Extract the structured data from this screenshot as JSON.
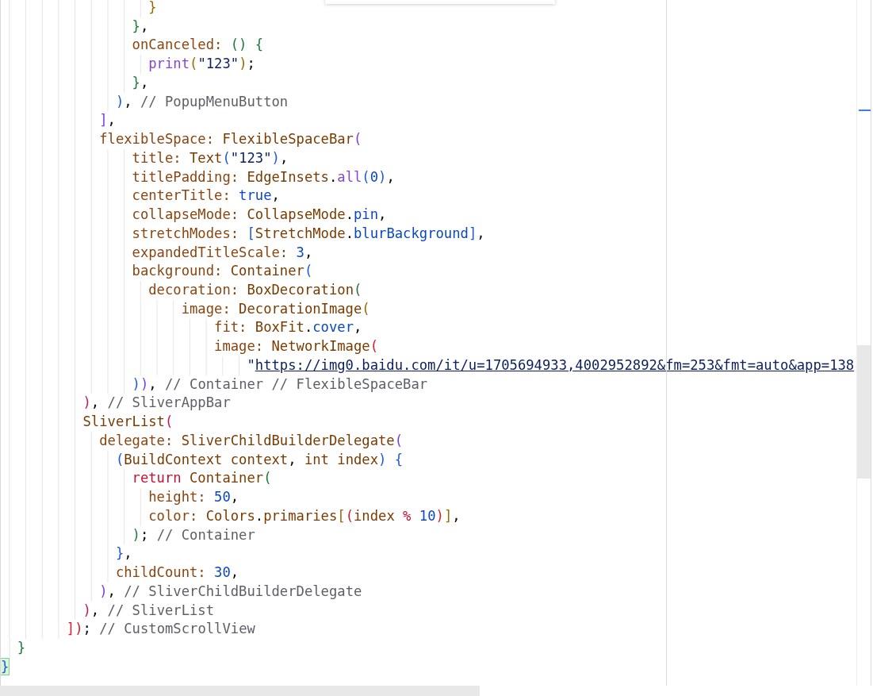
{
  "editor": {
    "lines": [
      {
        "tokens": [
          {
            "text": "                  }",
            "kind": "bo"
          }
        ]
      },
      {
        "tokens": [
          {
            "text": "                }",
            "kind": "bg"
          },
          {
            "text": ",",
            "kind": "p"
          }
        ]
      },
      {
        "tokens": [
          {
            "text": "                onCanceled: ",
            "kind": "k"
          },
          {
            "text": "()",
            "kind": "bg"
          },
          {
            "text": " {",
            "kind": "bg"
          }
        ]
      },
      {
        "tokens": [
          {
            "text": "                  print",
            "kind": "m"
          },
          {
            "text": "(",
            "kind": "bo"
          },
          {
            "text": "\"123\"",
            "kind": "s"
          },
          {
            "text": ")",
            "kind": "bo"
          },
          {
            "text": ";",
            "kind": "p"
          }
        ]
      },
      {
        "tokens": [
          {
            "text": "                }",
            "kind": "bg"
          },
          {
            "text": ",",
            "kind": "p"
          }
        ]
      },
      {
        "tokens": [
          {
            "text": "              )",
            "kind": "bb"
          },
          {
            "text": ", ",
            "kind": "p"
          },
          {
            "text": "// PopupMenuButton",
            "kind": "cm"
          }
        ]
      },
      {
        "tokens": [
          {
            "text": "            ]",
            "kind": "bp"
          },
          {
            "text": ",",
            "kind": "p"
          }
        ]
      },
      {
        "tokens": [
          {
            "text": "            flexibleSpace: ",
            "kind": "k"
          },
          {
            "text": "FlexibleSpaceBar",
            "kind": "c"
          },
          {
            "text": "(",
            "kind": "bp"
          }
        ]
      },
      {
        "tokens": [
          {
            "text": "                title: ",
            "kind": "k"
          },
          {
            "text": "Text",
            "kind": "c"
          },
          {
            "text": "(",
            "kind": "bb"
          },
          {
            "text": "\"123\"",
            "kind": "s"
          },
          {
            "text": ")",
            "kind": "bb"
          },
          {
            "text": ",",
            "kind": "p"
          }
        ]
      },
      {
        "tokens": [
          {
            "text": "                titlePadding: ",
            "kind": "k"
          },
          {
            "text": "EdgeInsets",
            "kind": "c"
          },
          {
            "text": ".",
            "kind": "p"
          },
          {
            "text": "all",
            "kind": "m"
          },
          {
            "text": "(",
            "kind": "bb"
          },
          {
            "text": "0",
            "kind": "n"
          },
          {
            "text": ")",
            "kind": "bb"
          },
          {
            "text": ",",
            "kind": "p"
          }
        ]
      },
      {
        "tokens": [
          {
            "text": "                centerTitle: ",
            "kind": "k"
          },
          {
            "text": "true",
            "kind": "n"
          },
          {
            "text": ",",
            "kind": "p"
          }
        ]
      },
      {
        "tokens": [
          {
            "text": "                collapseMode: ",
            "kind": "k"
          },
          {
            "text": "CollapseMode",
            "kind": "c"
          },
          {
            "text": ".",
            "kind": "p"
          },
          {
            "text": "pin",
            "kind": "n"
          },
          {
            "text": ",",
            "kind": "p"
          }
        ]
      },
      {
        "tokens": [
          {
            "text": "                stretchModes: ",
            "kind": "k"
          },
          {
            "text": "[",
            "kind": "bb"
          },
          {
            "text": "StretchMode",
            "kind": "c"
          },
          {
            "text": ".",
            "kind": "p"
          },
          {
            "text": "blurBackground",
            "kind": "n"
          },
          {
            "text": "]",
            "kind": "bb"
          },
          {
            "text": ",",
            "kind": "p"
          }
        ]
      },
      {
        "tokens": [
          {
            "text": "                expandedTitleScale: ",
            "kind": "k"
          },
          {
            "text": "3",
            "kind": "n"
          },
          {
            "text": ",",
            "kind": "p"
          }
        ]
      },
      {
        "tokens": [
          {
            "text": "                background: ",
            "kind": "k"
          },
          {
            "text": "Container",
            "kind": "c"
          },
          {
            "text": "(",
            "kind": "bb"
          }
        ]
      },
      {
        "tokens": [
          {
            "text": "                  decoration: ",
            "kind": "k"
          },
          {
            "text": "BoxDecoration",
            "kind": "c"
          },
          {
            "text": "(",
            "kind": "bg"
          }
        ]
      },
      {
        "tokens": [
          {
            "text": "                      image: ",
            "kind": "k"
          },
          {
            "text": "DecorationImage",
            "kind": "c"
          },
          {
            "text": "(",
            "kind": "bo"
          }
        ]
      },
      {
        "tokens": [
          {
            "text": "                          fit: ",
            "kind": "k"
          },
          {
            "text": "BoxFit",
            "kind": "c"
          },
          {
            "text": ".",
            "kind": "p"
          },
          {
            "text": "cover",
            "kind": "n"
          },
          {
            "text": ",",
            "kind": "p"
          }
        ]
      },
      {
        "tokens": [
          {
            "text": "                          image: ",
            "kind": "k"
          },
          {
            "text": "NetworkImage",
            "kind": "c"
          },
          {
            "text": "(",
            "kind": "br"
          }
        ]
      },
      {
        "tokens": [
          {
            "text": "                              \"",
            "kind": "s"
          },
          {
            "text": "https://img0.baidu.com/it/u=1705694933,4002952892&fm=253&fmt=auto&app=138",
            "kind": "u"
          }
        ]
      },
      {
        "tokens": [
          {
            "text": "                )",
            "kind": "bb"
          },
          {
            "text": ")",
            "kind": "bp"
          },
          {
            "text": ", ",
            "kind": "p"
          },
          {
            "text": "// Container // FlexibleSpaceBar",
            "kind": "cm"
          }
        ]
      },
      {
        "tokens": [
          {
            "text": "          )",
            "kind": "bk"
          },
          {
            "text": ", ",
            "kind": "p"
          },
          {
            "text": "// SliverAppBar",
            "kind": "cm"
          }
        ]
      },
      {
        "tokens": [
          {
            "text": "          SliverList",
            "kind": "c"
          },
          {
            "text": "(",
            "kind": "bk"
          }
        ]
      },
      {
        "tokens": [
          {
            "text": "            delegate: ",
            "kind": "k"
          },
          {
            "text": "SliverChildBuilderDelegate",
            "kind": "c"
          },
          {
            "text": "(",
            "kind": "bp"
          }
        ]
      },
      {
        "tokens": [
          {
            "text": "              (",
            "kind": "bb"
          },
          {
            "text": "BuildContext context",
            "kind": "c"
          },
          {
            "text": ", ",
            "kind": "p"
          },
          {
            "text": "int index",
            "kind": "c"
          },
          {
            "text": ")",
            "kind": "bb"
          },
          {
            "text": " {",
            "kind": "bb"
          }
        ]
      },
      {
        "tokens": [
          {
            "text": "                return ",
            "kind": "kw"
          },
          {
            "text": "Container",
            "kind": "c"
          },
          {
            "text": "(",
            "kind": "bg"
          }
        ]
      },
      {
        "tokens": [
          {
            "text": "                  height: ",
            "kind": "k"
          },
          {
            "text": "50",
            "kind": "n"
          },
          {
            "text": ",",
            "kind": "p"
          }
        ]
      },
      {
        "tokens": [
          {
            "text": "                  color: ",
            "kind": "k"
          },
          {
            "text": "Colors",
            "kind": "c"
          },
          {
            "text": ".",
            "kind": "p"
          },
          {
            "text": "primaries",
            "kind": "c"
          },
          {
            "text": "[",
            "kind": "bo"
          },
          {
            "text": "(",
            "kind": "br"
          },
          {
            "text": "index ",
            "kind": "c"
          },
          {
            "text": "% ",
            "kind": "kw"
          },
          {
            "text": "10",
            "kind": "n"
          },
          {
            "text": ")",
            "kind": "br"
          },
          {
            "text": "]",
            "kind": "bo"
          },
          {
            "text": ",",
            "kind": "p"
          }
        ]
      },
      {
        "tokens": [
          {
            "text": "                )",
            "kind": "bg"
          },
          {
            "text": "; ",
            "kind": "p"
          },
          {
            "text": "// Container",
            "kind": "cm"
          }
        ]
      },
      {
        "tokens": [
          {
            "text": "              }",
            "kind": "bb"
          },
          {
            "text": ",",
            "kind": "p"
          }
        ]
      },
      {
        "tokens": [
          {
            "text": "              childCount: ",
            "kind": "k"
          },
          {
            "text": "30",
            "kind": "n"
          },
          {
            "text": ",",
            "kind": "p"
          }
        ]
      },
      {
        "tokens": [
          {
            "text": "            )",
            "kind": "bp"
          },
          {
            "text": ", ",
            "kind": "p"
          },
          {
            "text": "// SliverChildBuilderDelegate",
            "kind": "cm"
          }
        ]
      },
      {
        "tokens": [
          {
            "text": "          )",
            "kind": "bk"
          },
          {
            "text": ", ",
            "kind": "p"
          },
          {
            "text": "// SliverList",
            "kind": "cm"
          }
        ]
      },
      {
        "tokens": [
          {
            "text": "        ]",
            "kind": "br"
          },
          {
            "text": ")",
            "kind": "br"
          },
          {
            "text": "; ",
            "kind": "p"
          },
          {
            "text": "// CustomScrollView",
            "kind": "cm"
          }
        ]
      },
      {
        "tokens": [
          {
            "text": "  }",
            "kind": "bg"
          }
        ]
      },
      {
        "tokens": [
          {
            "text": "}",
            "kind": "bmatch"
          }
        ]
      }
    ]
  }
}
